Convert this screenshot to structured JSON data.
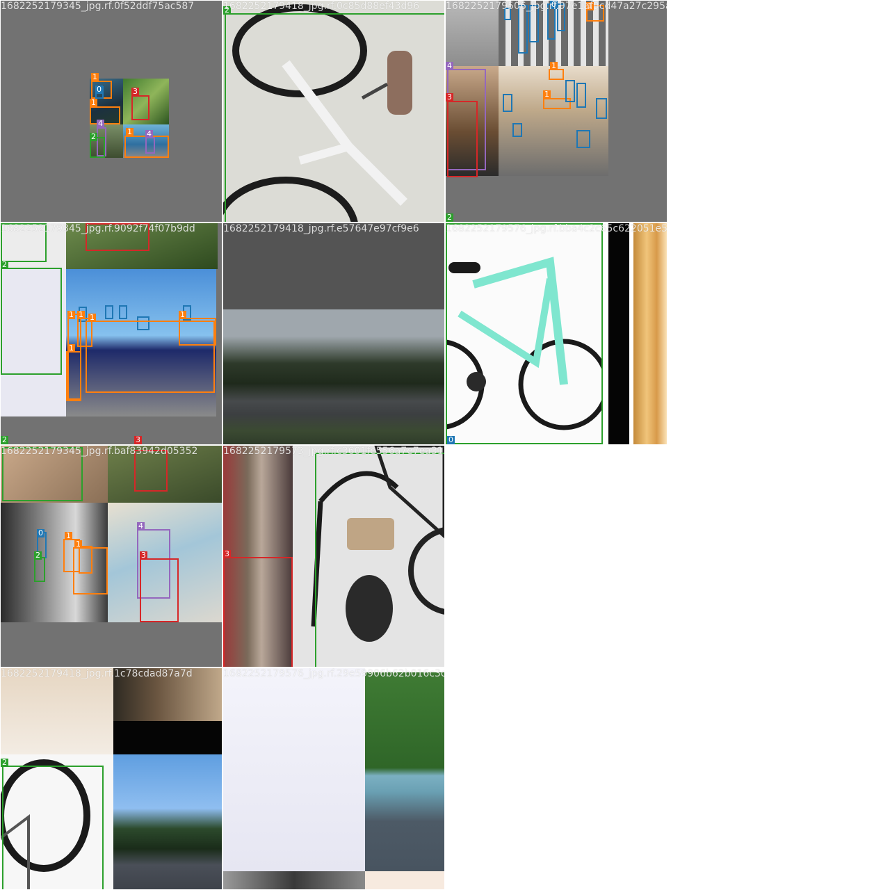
{
  "colors": {
    "class_0": "#1f77b4",
    "class_1": "#ff7f0e",
    "class_2": "#2ca02c",
    "class_3": "#d62728",
    "class_4": "#9467bd",
    "padding": "#727272"
  },
  "tiles": [
    {
      "filename": "1682252179345_jpg.rf.0f52ddf75ac587"
    },
    {
      "filename": "1682252179418_jpg.rf.0c85d88ef43d96"
    },
    {
      "filename": "1682252179506_jpg.rf.97e1af9cd47a27c295a"
    },
    {
      "filename": "1682252179345_jpg.rf.9092f74f07b9dd"
    },
    {
      "filename": "1682252179418_jpg.rf.e57647e97cf9e6"
    },
    {
      "filename": "1682252179576_jpg.rf.bba4c2c65c622051e578"
    },
    {
      "filename": "1682252179345_jpg.rf.baf83942d05352"
    },
    {
      "filename": "1682252179573_jpg.rf.c3601fe556a7e7ea317"
    },
    {
      "filename": "1682252179418_jpg.rf.1c78cdad87a7d"
    },
    {
      "filename": "1682252179576_jpg.rf.29e59906b62b016c3c5"
    }
  ],
  "labels": {
    "l0": "0",
    "l1": "1",
    "l2": "2",
    "l3": "3",
    "l4": "4"
  }
}
